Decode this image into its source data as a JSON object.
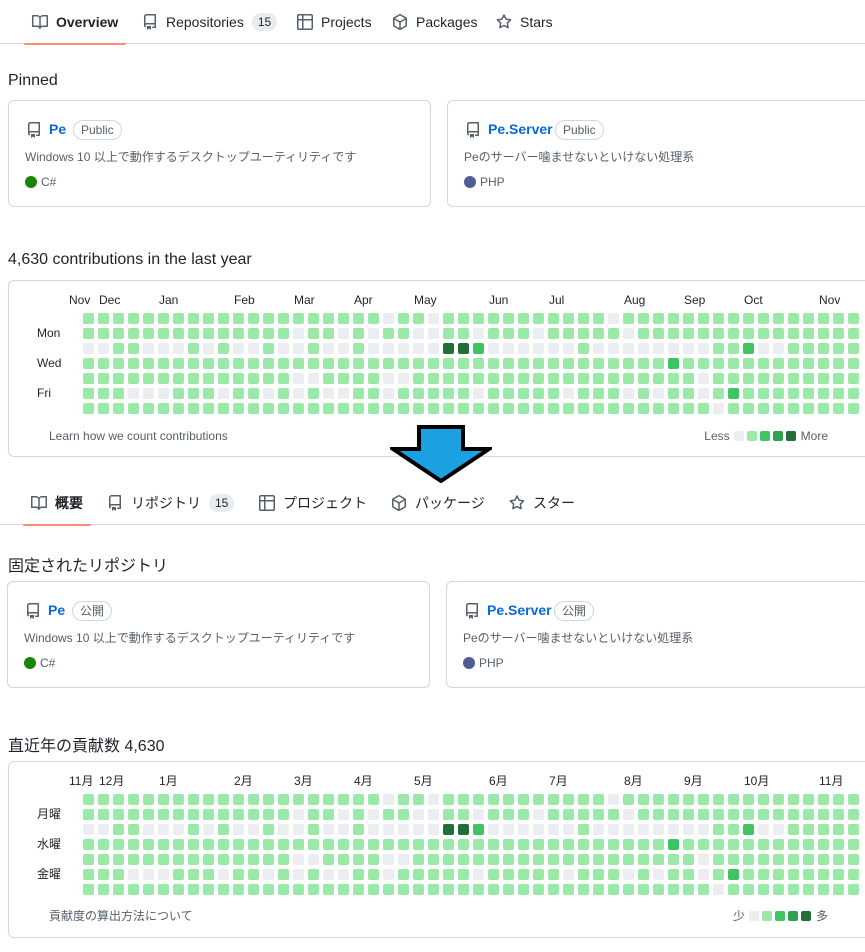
{
  "colors": {
    "accent_underline": "#fd8c73",
    "link": "#0969da",
    "csharp": "#178600",
    "php": "#4F5D95",
    "levels": [
      "#ebedf0",
      "#9be9a8",
      "#40c463",
      "#30a14e",
      "#216e39"
    ],
    "arrow_fill": "#1ba1e2"
  },
  "en": {
    "tabs": [
      {
        "label": "Overview",
        "icon": "book-icon"
      },
      {
        "label": "Repositories",
        "icon": "repo-icon",
        "count": "15"
      },
      {
        "label": "Projects",
        "icon": "table-icon"
      },
      {
        "label": "Packages",
        "icon": "package-icon"
      },
      {
        "label": "Stars",
        "icon": "star-icon"
      }
    ],
    "pinned_title": "Pinned",
    "cards": [
      {
        "name": "Pe",
        "visibility": "Public",
        "description": "Windows 10 以上で動作するデスクトップユーティリティです",
        "language": "C#"
      },
      {
        "name": "Pe.Server",
        "visibility": "Public",
        "description": "Peのサーバー噛ませないといけない処理系",
        "language": "PHP"
      }
    ],
    "contrib_title": "4,630 contributions in the last year",
    "months": [
      "Nov",
      "Dec",
      "Jan",
      "Feb",
      "Mar",
      "Apr",
      "May",
      "Jun",
      "Jul",
      "Aug",
      "Sep",
      "Oct",
      "Nov"
    ],
    "days": [
      "Mon",
      "Wed",
      "Fri"
    ],
    "learn": "Learn how we count contributions",
    "less": "Less",
    "more": "More"
  },
  "ja": {
    "tabs": [
      {
        "label": "概要",
        "icon": "book-icon"
      },
      {
        "label": "リポジトリ",
        "icon": "repo-icon",
        "count": "15"
      },
      {
        "label": "プロジェクト",
        "icon": "table-icon"
      },
      {
        "label": "パッケージ",
        "icon": "package-icon"
      },
      {
        "label": "スター",
        "icon": "star-icon"
      }
    ],
    "pinned_title": "固定されたリポジトリ",
    "cards": [
      {
        "name": "Pe",
        "visibility": "公開",
        "description": "Windows 10 以上で動作するデスクトップユーティリティです",
        "language": "C#"
      },
      {
        "name": "Pe.Server",
        "visibility": "公開",
        "description": "Peのサーバー噛ませないといけない処理系",
        "language": "PHP"
      }
    ],
    "contrib_title": "直近年の貢献数 4,630",
    "months": [
      "11月",
      "12月",
      "1月",
      "2月",
      "3月",
      "4月",
      "5月",
      "6月",
      "7月",
      "8月",
      "9月",
      "10月",
      "11月"
    ],
    "days": [
      "月曜",
      "水曜",
      "金曜"
    ],
    "learn": "貢献度の算出方法について",
    "less": "少",
    "more": "多"
  },
  "contribution_grid": [
    "1111111111111111111101101111111111101111111111111111",
    "1111111111111101101011001101110111110111111111111111",
    "0011000101001001001000004420000001000000001120011111",
    "1111111111111111111111111111111111111112111111111111",
    "1111111111111100111100111111111111111111101111111111",
    "1110001110110101001101111101111101110101101211111111",
    "1111111111111111111111111111111111111111110111111111"
  ]
}
